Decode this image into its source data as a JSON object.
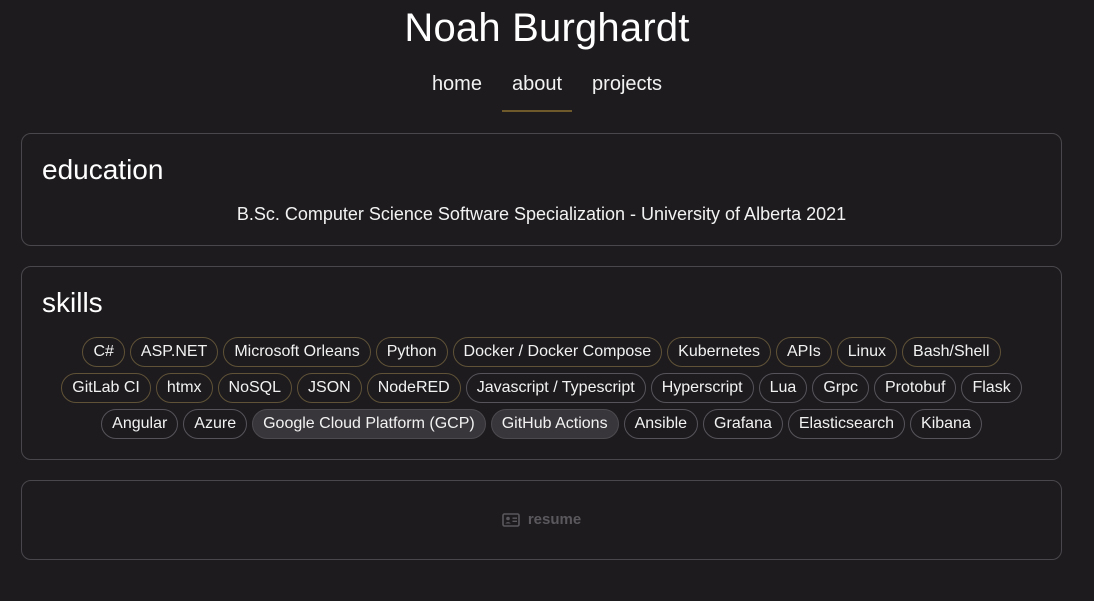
{
  "site": {
    "title": "Noah Burghardt"
  },
  "nav": {
    "items": [
      "home",
      "about",
      "projects"
    ],
    "active": "about"
  },
  "education": {
    "title": "education",
    "line": "B.Sc. Computer Science Software Specialization - University of Alberta 2021"
  },
  "skills": {
    "title": "skills",
    "items": [
      "C#",
      "ASP.NET",
      "Microsoft Orleans",
      "Python",
      "Docker / Docker Compose",
      "Kubernetes",
      "APIs",
      "Linux",
      "Bash/Shell",
      "GitLab CI",
      "htmx",
      "NoSQL",
      "JSON",
      "NodeRED",
      "Javascript / Typescript",
      "Hyperscript",
      "Lua",
      "Grpc",
      "Protobuf",
      "Flask",
      "Angular",
      "Azure",
      "Google Cloud Platform (GCP)",
      "GitHub Actions",
      "Ansible",
      "Grafana",
      "Elasticsearch",
      "Kibana"
    ]
  },
  "resume": {
    "label": "resume",
    "icon": "id-card-icon"
  },
  "colors": {
    "background": "#1d1b1e",
    "accent": "#6e5a2b",
    "border": "#4a474c"
  }
}
